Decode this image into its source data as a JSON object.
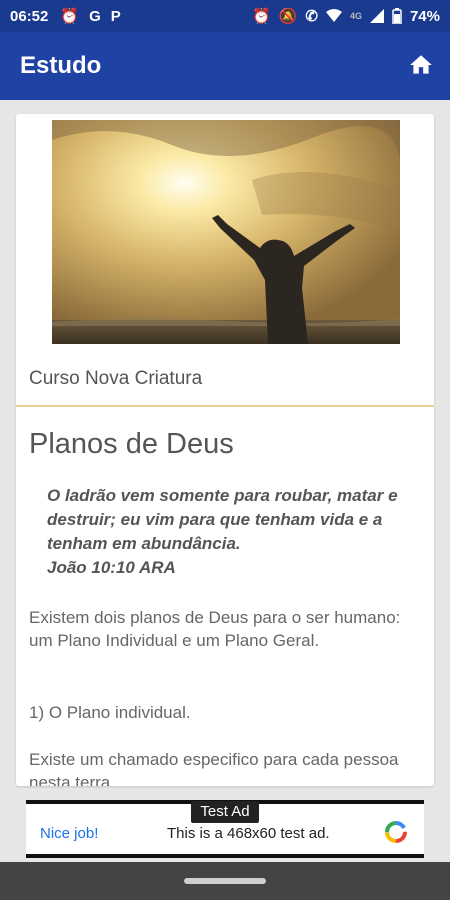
{
  "status": {
    "time": "06:52",
    "battery": "74%",
    "network": "4G",
    "left_icons": [
      "alarm-icon",
      "google-icon",
      "pinterest-icon"
    ],
    "right_icons": [
      "alarm-icon",
      "mute-icon",
      "call-icon",
      "wifi-icon",
      "signal-icon",
      "battery-icon"
    ]
  },
  "appbar": {
    "title": "Estudo",
    "home_icon": "home-icon"
  },
  "content": {
    "course": "Curso Nova Criatura",
    "title": "Planos de Deus",
    "quote": "O ladrão vem somente para roubar, matar e destruir; eu vim para que tenham vida e a tenham em abundância.",
    "quote_ref": "João 10:10 ARA",
    "para1": "Existem dois planos de Deus para o ser humano: um Plano Individual e um Plano Geral.",
    "para2": "1) O Plano individual.",
    "para3": "Existe um chamado especifico para cada pessoa nesta terra."
  },
  "ad": {
    "label": "Test Ad",
    "cta": "Nice job!",
    "text": "This is a 468x60 test ad."
  },
  "colors": {
    "appbar": "#1f43a5",
    "statusbar": "#1a3a8f",
    "divider": "#e9cf94",
    "link": "#1a73e8"
  }
}
